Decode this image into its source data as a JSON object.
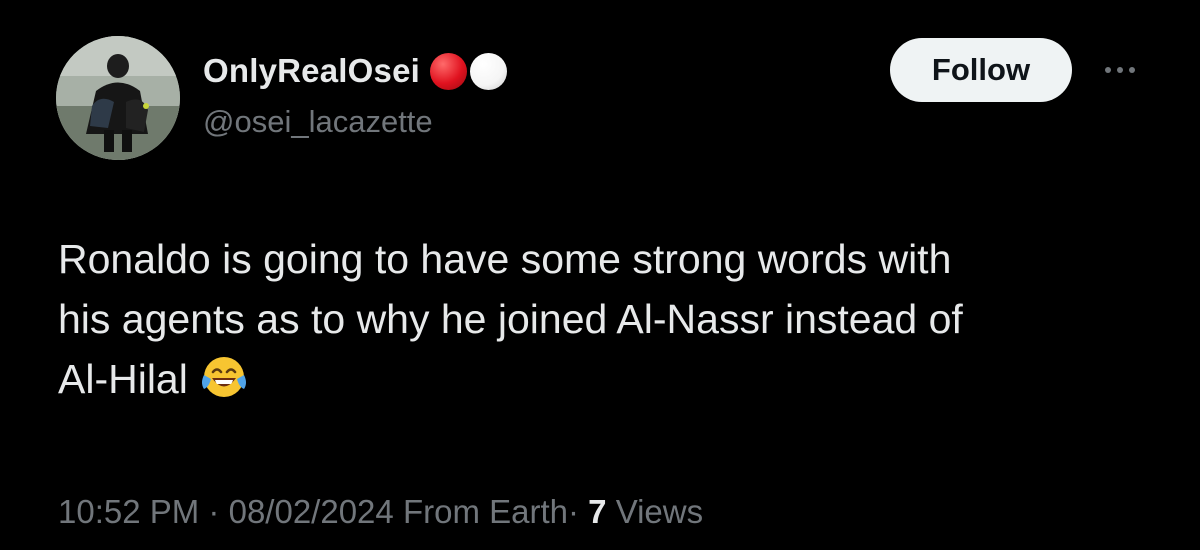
{
  "user": {
    "display_name": "OnlyRealOsei",
    "handle": "@osei_lacazette",
    "badge_colors": [
      "#e0121f",
      "#f5f5f5"
    ]
  },
  "actions": {
    "follow_label": "Follow",
    "more_icon": "more-horizontal-icon"
  },
  "tweet": {
    "lines": [
      "Ronaldo is going to have some strong words with",
      "his agents as to why he joined Al-Nassr instead of",
      "Al-Hilal"
    ],
    "emoji": "face-with-tears-of-joy-icon"
  },
  "meta": {
    "time": "10:52 PM",
    "separator": "·",
    "date": "08/02/2024",
    "source": "From Earth",
    "views_count": "7",
    "views_label": "Views"
  },
  "colors": {
    "background": "#000000",
    "text_primary": "#e7e9ea",
    "text_secondary": "#71767b",
    "follow_bg": "#eff3f4"
  }
}
